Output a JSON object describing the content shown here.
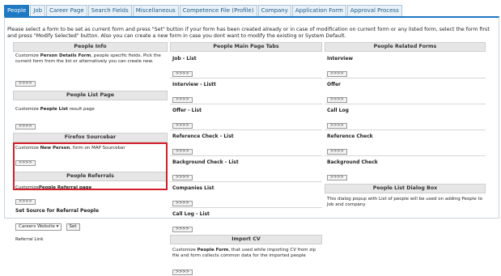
{
  "tabs": [
    "People",
    "Job",
    "Career Page",
    "Search Fields",
    "Miscellaneous",
    "Competence File (Profile)",
    "Company",
    "Application Form",
    "Approval Process"
  ],
  "intro": "Please select a form to be set as current form and press \"Set\" button if your form has been created already or in case of modification on current form or any listed form, select the form first and press \"Modify Selected\" button. Also you can create a new form in case you dont want to modify the existing or System Default.",
  "button_label": ">>>>",
  "left": {
    "people_info": {
      "title": "People Info",
      "text_pre": "Customize ",
      "text_bold": "Person Details Form",
      "text_post": ", people specific fields. Pick the current form from the list or alternatively you can create new."
    },
    "people_list": {
      "title": "People List Page",
      "text_pre": "Customize ",
      "text_bold": "People List",
      "text_post": " result page"
    },
    "firefox": {
      "title": "Firefox Sourcebar",
      "text_pre": "Customize ",
      "text_bold": "New Person",
      "text_post": ", form on MAP Sourcebar"
    },
    "referrals": {
      "title": "People Referrals",
      "text_pre": "Customize",
      "text_bold": "People Referral page",
      "source_label": "Set Source for Referral People",
      "select_value": "Careers Website",
      "set_label": "Set"
    },
    "footer_link": "Referral Link"
  },
  "middle": {
    "title": "People Main Page Tabs",
    "items": [
      "Job - List",
      "Interview - Listt",
      "Offer - List",
      "Reference Check - List",
      "Background Check - List",
      "Companies List",
      "Call Log - List"
    ],
    "import": {
      "title": "Import CV",
      "text_pre": "Customize ",
      "text_bold": "People Form",
      "text_post": ", that used while importing CV from zip file and form collects common data for the imported people"
    }
  },
  "right": {
    "title": "People Related Forms",
    "items": [
      "Interview",
      "Offer",
      "Call Log",
      "Reference Check",
      "Background Check"
    ],
    "dialog": {
      "title": "People List Dialog Box",
      "text": "This dialog popup with List of people will be used on adding People to Job and company"
    }
  }
}
